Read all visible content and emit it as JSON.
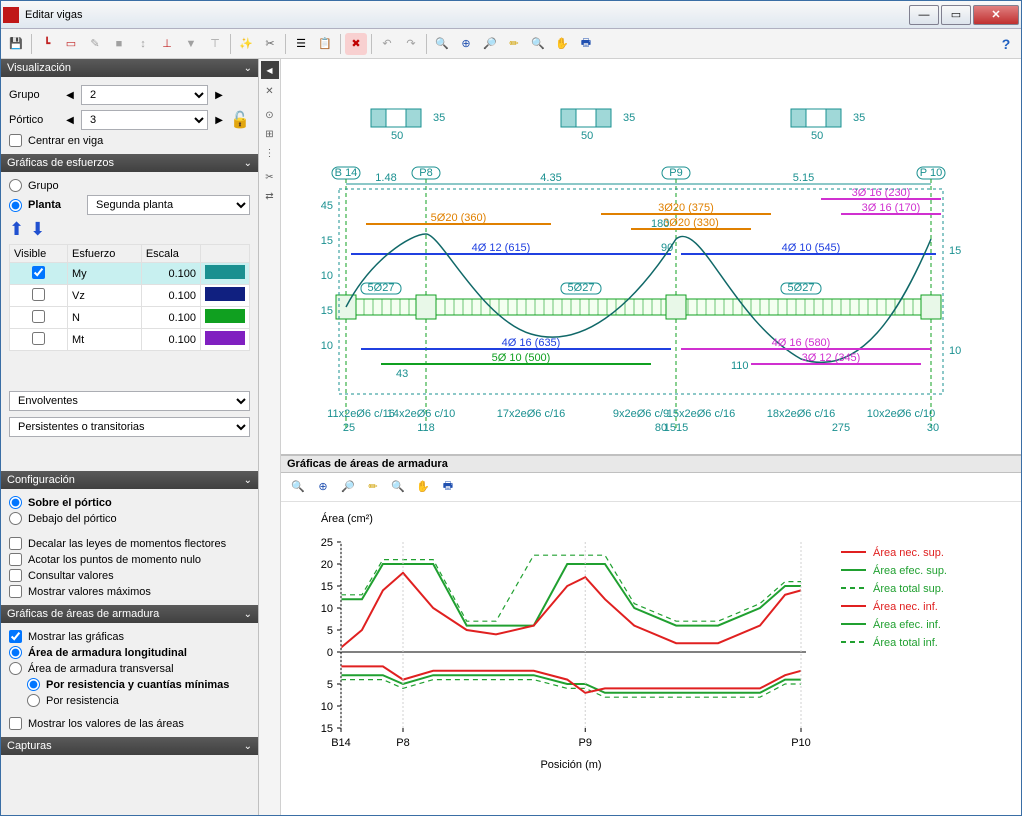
{
  "window": {
    "title": "Editar vigas"
  },
  "panels": {
    "visualizacion": {
      "title": "Visualización",
      "grupo_label": "Grupo",
      "grupo_value": "2",
      "portico_label": "Pórtico",
      "portico_value": "3",
      "centrar": "Centrar en viga"
    },
    "graficas_esfuerzos": {
      "title": "Gráficas de esfuerzos",
      "grupo_option": "Grupo",
      "planta_option": "Planta",
      "planta_value": "Segunda planta",
      "col_visible": "Visible",
      "col_esfuerzo": "Esfuerzo",
      "col_escala": "Escala",
      "rows": [
        {
          "esfuerzo": "My",
          "escala": "0.100",
          "color": "#1a9090",
          "checked": true
        },
        {
          "esfuerzo": "Vz",
          "escala": "0.100",
          "color": "#102080",
          "checked": false
        },
        {
          "esfuerzo": "N",
          "escala": "0.100",
          "color": "#10a020",
          "checked": false
        },
        {
          "esfuerzo": "Mt",
          "escala": "0.100",
          "color": "#8020c0",
          "checked": false
        }
      ],
      "envolventes": "Envolventes",
      "persistentes": "Persistentes o transitorias"
    },
    "configuracion": {
      "title": "Configuración",
      "sobre": "Sobre el pórtico",
      "debajo": "Debajo del pórtico",
      "decalar": "Decalar las leyes de momentos flectores",
      "acotar": "Acotar los puntos de momento nulo",
      "consultar": "Consultar valores",
      "mostrar_max": "Mostrar valores máximos"
    },
    "graficas_armadura": {
      "title": "Gráficas de áreas de armadura",
      "mostrar": "Mostrar las gráficas",
      "area_long": "Área de armadura longitudinal",
      "area_trans": "Área de armadura transversal",
      "por_res_min": "Por resistencia y cuantías mínimas",
      "por_res": "Por resistencia",
      "mostrar_vals": "Mostrar los valores de las áreas"
    },
    "capturas": {
      "title": "Capturas"
    }
  },
  "chart_header": "Gráficas de áreas de armadura",
  "chart_ylabel": "Área (cm²)",
  "chart_xlabel": "Posición (m)",
  "legend": {
    "nec_sup": "Área nec. sup.",
    "efec_sup": "Área efec. sup.",
    "total_sup": "Área total sup.",
    "nec_inf": "Área nec. inf.",
    "efec_inf": "Área efec. inf.",
    "total_inf": "Área total inf."
  },
  "chart_data": {
    "type": "line",
    "xlabel": "Posición (m)",
    "ylabel": "Área (cm²)",
    "x_ticks_labels": [
      "B14",
      "P8",
      "P9",
      "P10"
    ],
    "x_ticks_pos": [
      0,
      1.48,
      5.83,
      10.98
    ],
    "y_ticks_top": [
      0,
      5,
      10,
      15,
      20,
      25
    ],
    "y_ticks_bot": [
      0,
      5,
      10,
      15
    ],
    "x": [
      0,
      0.5,
      1.0,
      1.48,
      2.2,
      3.0,
      3.7,
      4.6,
      5.4,
      5.83,
      6.3,
      7.0,
      8.0,
      9.0,
      10.0,
      10.6,
      10.98
    ],
    "nec_sup": [
      1,
      5,
      14,
      18,
      10,
      5,
      4,
      6,
      15,
      17,
      12,
      6,
      2,
      2,
      6,
      13,
      14
    ],
    "efec_sup": [
      12,
      12,
      20,
      20,
      20,
      6,
      6,
      6,
      20,
      20,
      20,
      10,
      6,
      6,
      10,
      15,
      15
    ],
    "total_sup": [
      13,
      13,
      21,
      21,
      21,
      7,
      7,
      22,
      22,
      22,
      22,
      11,
      7,
      7,
      11,
      16,
      16
    ],
    "nec_inf": [
      1,
      1,
      1,
      4,
      2,
      2,
      2,
      2,
      4,
      7,
      6,
      6,
      6,
      6,
      6,
      3,
      2
    ],
    "efec_inf": [
      3,
      3,
      3,
      5,
      3,
      3,
      3,
      3,
      5,
      5,
      7,
      7,
      7,
      7,
      7,
      4,
      4
    ],
    "total_inf": [
      4,
      4,
      4,
      6,
      4,
      4,
      4,
      4,
      6,
      6,
      8,
      8,
      8,
      8,
      8,
      5,
      5
    ]
  },
  "diagram_labels": {
    "b14": "B 14",
    "p8": "P8",
    "p9": "P9",
    "p10": "P 10",
    "dim_148": "1.48",
    "dim_435": "4.35",
    "dim_515": "5.15",
    "reb1": "5Ø20 (360)",
    "reb2": "3Ø20 (375)",
    "reb3": "3Ø 16 (230)",
    "reb4": "3Ø 16 (170)",
    "reb5": "3Ø20 (330)",
    "reb6": "4Ø 12 (615)",
    "reb7": "4Ø 10 (545)",
    "reb8": "5Ø27",
    "reb9": "5Ø27",
    "reb10": "5Ø27",
    "reb11": "4Ø 16 (635)",
    "reb12": "5Ø 10 (500)",
    "reb13": "4Ø 16 (580)",
    "reb14": "3Ø 12 (345)",
    "d180": "180",
    "d90": "90",
    "d110": "110",
    "d43": "43",
    "d10": "10",
    "d50": "50",
    "s1": "11x2eØ6 c/16",
    "s2": "14x2eØ6 c/10",
    "s3": "17x2eØ6 c/16",
    "s4": "9x2eØ6 c/9",
    "s5": "15x2eØ6 c/16",
    "s6": "18x2eØ6 c/16",
    "s7": "10x2eØ6 c/10",
    "p25": "25",
    "p118": "118",
    "p80": "80",
    "p1515": "1515",
    "p275": "275",
    "p30": "30"
  }
}
